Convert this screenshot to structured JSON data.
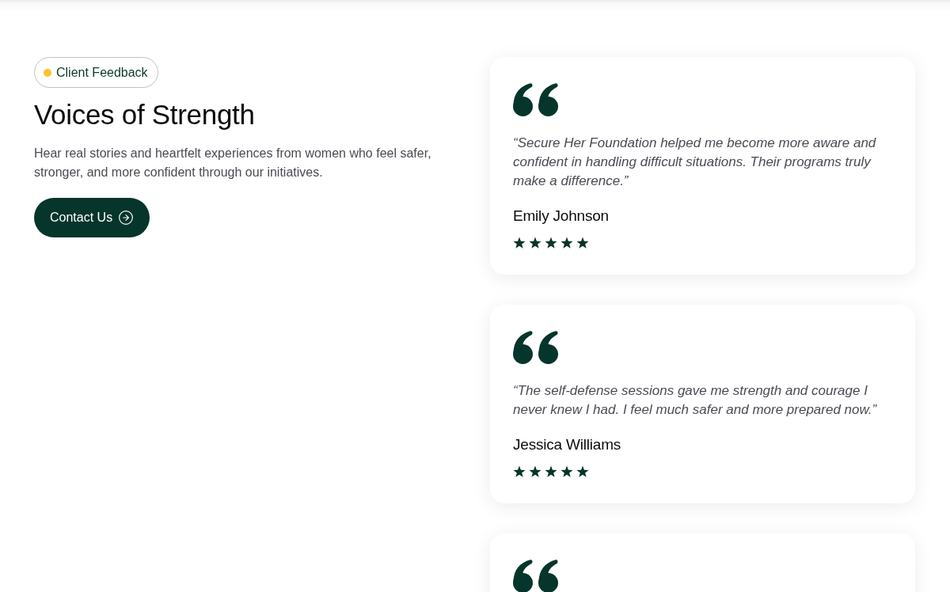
{
  "intro": {
    "badge": "Client Feedback",
    "title": "Voices of Strength",
    "description": "Hear real stories and heartfelt experiences from women who feel safer, stronger, and more confident through our initiatives.",
    "button": "Contact Us"
  },
  "testimonials": [
    {
      "kind": "review",
      "quote": "“Secure Her Foundation helped me become more aware and confident in handling difficult situations. Their programs truly make a difference.”",
      "name": "Emily Johnson",
      "stars": 5
    },
    {
      "kind": "review",
      "quote": "“The self-defense sessions gave me strength and courage I never knew I had. I feel much safer and more prepared now.”",
      "name": "Jessica Williams",
      "stars": 5
    },
    {
      "kind": "cut_off"
    }
  ]
}
